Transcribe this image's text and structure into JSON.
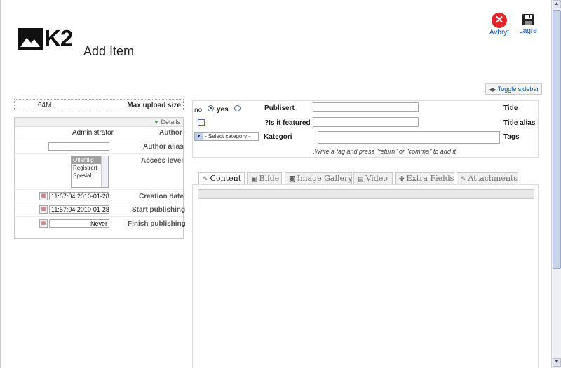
{
  "header": {
    "logo_text": "K2",
    "title": "Add Item"
  },
  "toolbar": {
    "cancel_label": "Avbryt",
    "save_label": "Lagre"
  },
  "toggle_sidebar": "Toggle sidebar",
  "sidebar": {
    "max_upload_value": "64M",
    "max_upload_label": "Max upload size",
    "details_label": "Details",
    "author_value": "Administrator",
    "author_label": "Author",
    "author_alias_label": "Author alias",
    "author_alias_value": "",
    "access_level_label": "Access level",
    "access_options": [
      "Offentlig",
      "Registrert",
      "Spesial"
    ],
    "access_selected": "Offentlig",
    "creation_date_label": "Creation date",
    "creation_date_value": "11:57:04 2010-01-28",
    "start_publishing_label": "Start publishing",
    "start_publishing_value": "11:57:04 2010-01-28",
    "finish_publishing_label": "Finish publishing",
    "finish_publishing_value": "Never"
  },
  "form": {
    "published_no": "no",
    "published_yes": "yes",
    "published_selected": "yes",
    "published_label": "Publisert",
    "title_label": "Title",
    "title_value": "",
    "featured_label": "?Is it featured",
    "featured_checked": false,
    "title_alias_label": "Title alias",
    "title_alias_value": "",
    "category_select": "- Select category -",
    "category_label": "Kategori",
    "tags_label": "Tags",
    "tags_value": "",
    "tags_hint": ".Write a tag and press \"return\" or \"comma\" to add it"
  },
  "tabs": [
    {
      "label": "Content",
      "icon": "edit-icon",
      "active": true
    },
    {
      "label": "Bilde",
      "icon": "image-icon",
      "active": false
    },
    {
      "label": "Image Gallery",
      "icon": "camera-icon",
      "active": false
    },
    {
      "label": "Video",
      "icon": "film-icon",
      "active": false
    },
    {
      "label": "Extra Fields",
      "icon": "puzzle-icon",
      "active": false
    },
    {
      "label": "Attachments",
      "icon": "paperclip-icon",
      "active": false
    }
  ],
  "colors": {
    "link_blue": "#0b55c4",
    "cancel_red": "#e0242b",
    "details_arrow_green": "#3a9a3a"
  }
}
